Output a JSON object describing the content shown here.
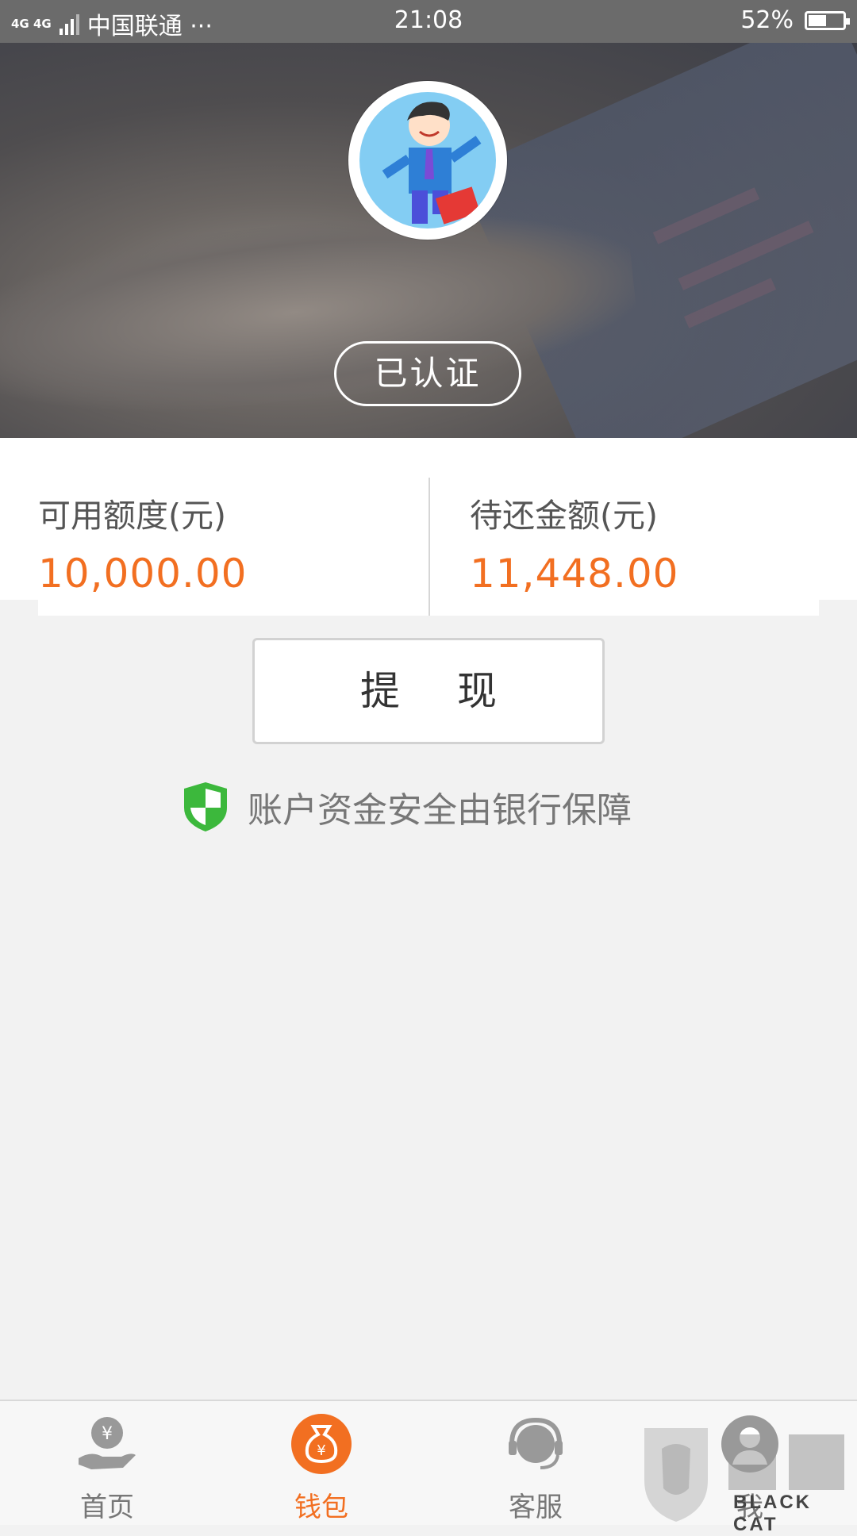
{
  "status_bar": {
    "network": "4G 4G",
    "carrier": "中国联通 ···",
    "time": "21:08",
    "battery": "52%",
    "battery_level": 0.52
  },
  "profile": {
    "verified_label": "已认证"
  },
  "credit": {
    "available_label": "可用额度(元)",
    "available_value": "10,000.00",
    "due_label": "待还金额(元)",
    "due_value": "11,448.00"
  },
  "withdraw_button": "提 现",
  "security_note": "账户资金安全由银行保障",
  "bottom_nav": [
    {
      "label": "首页",
      "icon": "hand-coin-icon",
      "active": false
    },
    {
      "label": "钱包",
      "icon": "money-bag-icon",
      "active": true
    },
    {
      "label": "客服",
      "icon": "headset-icon",
      "active": false
    },
    {
      "label": "我",
      "icon": "person-icon",
      "active": false
    }
  ],
  "watermark": "BLACK CAT",
  "colors": {
    "accent": "#f26f21",
    "shield_green": "#3cb83c",
    "status_bar": "#6b6b6b"
  }
}
